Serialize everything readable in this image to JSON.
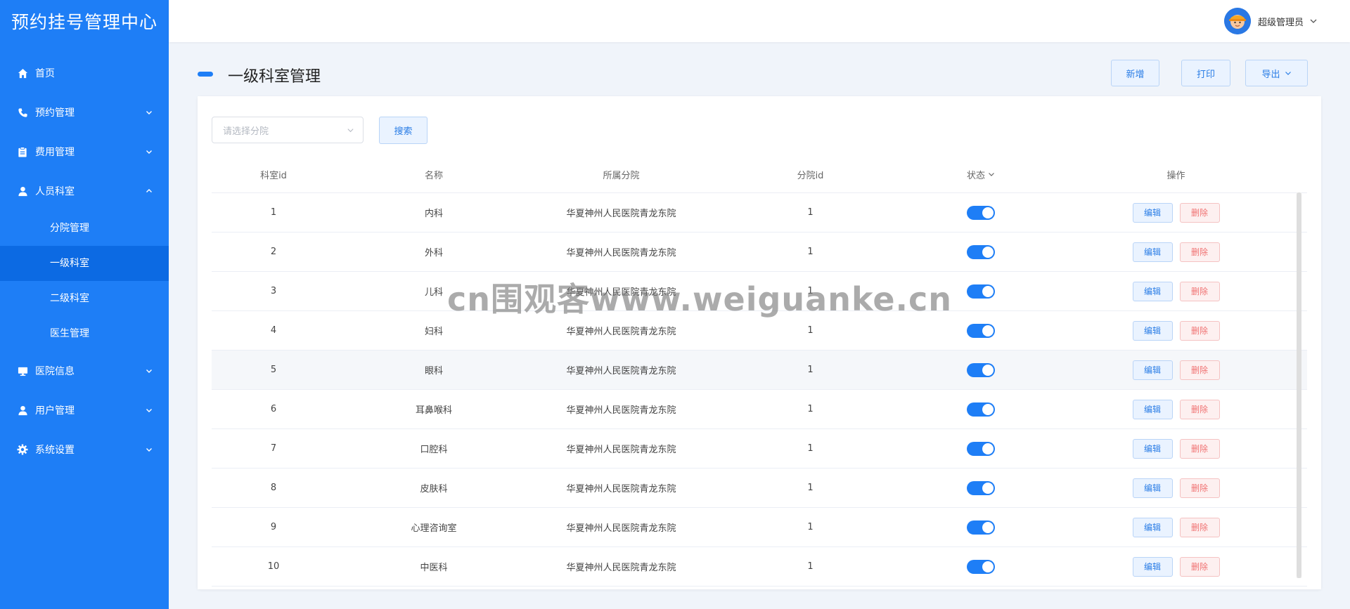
{
  "sidebar": {
    "title": "预约挂号管理中心",
    "items": [
      {
        "label": "首页",
        "icon": "home-icon"
      },
      {
        "label": "预约管理",
        "icon": "phone-icon"
      },
      {
        "label": "费用管理",
        "icon": "clipboard-icon"
      },
      {
        "label": "人员科室",
        "icon": "user-icon",
        "children": [
          "分院管理",
          "一级科室",
          "二级科室",
          "医生管理"
        ],
        "active_child": "一级科室"
      },
      {
        "label": "医院信息",
        "icon": "monitor-icon"
      },
      {
        "label": "用户管理",
        "icon": "user-icon"
      },
      {
        "label": "系统设置",
        "icon": "gear-icon"
      }
    ]
  },
  "header": {
    "user_name": "超级管理员"
  },
  "page": {
    "title": "一级科室管理",
    "buttons": {
      "add": "新增",
      "print": "打印",
      "export": "导出"
    }
  },
  "filter": {
    "branch_placeholder": "请选择分院",
    "search_label": "搜索"
  },
  "table": {
    "columns": [
      "科室id",
      "名称",
      "所属分院",
      "分院id",
      "状态",
      "操作"
    ],
    "edit_label": "编辑",
    "delete_label": "删除",
    "rows": [
      {
        "id": "1",
        "name": "内科",
        "branch": "华夏神州人民医院青龙东院",
        "branch_id": "1",
        "status_on": true
      },
      {
        "id": "2",
        "name": "外科",
        "branch": "华夏神州人民医院青龙东院",
        "branch_id": "1",
        "status_on": true
      },
      {
        "id": "3",
        "name": "儿科",
        "branch": "华夏神州人民医院青龙东院",
        "branch_id": "1",
        "status_on": true
      },
      {
        "id": "4",
        "name": "妇科",
        "branch": "华夏神州人民医院青龙东院",
        "branch_id": "1",
        "status_on": true
      },
      {
        "id": "5",
        "name": "眼科",
        "branch": "华夏神州人民医院青龙东院",
        "branch_id": "1",
        "status_on": true
      },
      {
        "id": "6",
        "name": "耳鼻喉科",
        "branch": "华夏神州人民医院青龙东院",
        "branch_id": "1",
        "status_on": true
      },
      {
        "id": "7",
        "name": "口腔科",
        "branch": "华夏神州人民医院青龙东院",
        "branch_id": "1",
        "status_on": true
      },
      {
        "id": "8",
        "name": "皮肤科",
        "branch": "华夏神州人民医院青龙东院",
        "branch_id": "1",
        "status_on": true
      },
      {
        "id": "9",
        "name": "心理咨询室",
        "branch": "华夏神州人民医院青龙东院",
        "branch_id": "1",
        "status_on": true
      },
      {
        "id": "10",
        "name": "中医科",
        "branch": "华夏神州人民医院青龙东院",
        "branch_id": "1",
        "status_on": true
      }
    ]
  },
  "watermark": "cn围观客www.weiguanke.cn",
  "colors": {
    "primary": "#1e7ef6",
    "active_menu": "#0c6ae3",
    "danger": "#f07272"
  }
}
